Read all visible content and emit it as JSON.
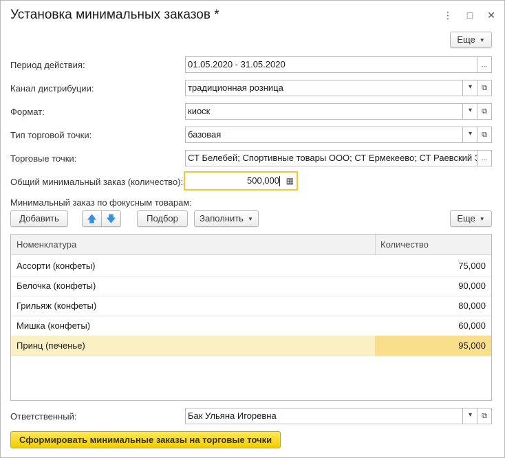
{
  "window": {
    "title": "Установка минимальных заказов *",
    "menu_icon": "⋮",
    "maximize_icon": "□",
    "close_icon": "✕"
  },
  "top_more_label": "Еще",
  "form": {
    "period": {
      "label": "Период действия:",
      "value": "01.05.2020 - 31.05.2020"
    },
    "channel": {
      "label": "Канал дистрибуции:",
      "value": "традиционная розница"
    },
    "format": {
      "label": "Формат:",
      "value": "киоск"
    },
    "outlet_type": {
      "label": "Тип торговой точки:",
      "value": "базовая"
    },
    "outlets": {
      "label": "Торговые точки:",
      "value": "СТ Белебей; Спортивные товары ООО; СТ Ермекеево; СТ Раевский ЗАО"
    },
    "total_min": {
      "label": "Общий минимальный заказ (количество):",
      "value": "500,000"
    }
  },
  "focus_section_label": "Минимальный заказ по фокусным товарам:",
  "toolbar": {
    "add_label": "Добавить",
    "up_icon": "🡅",
    "down_icon": "🡇",
    "pick_label": "Подбор",
    "fill_label": "Заполнить",
    "more_label": "Еще"
  },
  "table": {
    "columns": [
      "Номенклатура",
      "Количество"
    ],
    "rows": [
      {
        "name": "Ассорти (конфеты)",
        "qty": "75,000"
      },
      {
        "name": "Белочка (конфеты)",
        "qty": "90,000"
      },
      {
        "name": "Грильяж (конфеты)",
        "qty": "80,000"
      },
      {
        "name": "Мишка (конфеты)",
        "qty": "60,000"
      },
      {
        "name": "Принц (печенье)",
        "qty": "95,000"
      }
    ]
  },
  "responsible": {
    "label": "Ответственный:",
    "value": "Бак Ульяна Игоревна"
  },
  "submit_label": "Сформировать минимальные заказы на торговые точки",
  "icons": {
    "dropdown": "▾",
    "open": "⧉",
    "ellipsis": "...",
    "calculator": "▦"
  },
  "colors": {
    "accent_border": "#f2c531",
    "selected_row": "#fbefc4",
    "selected_cell": "#f9df8c",
    "primary_button": "#f5d417"
  }
}
